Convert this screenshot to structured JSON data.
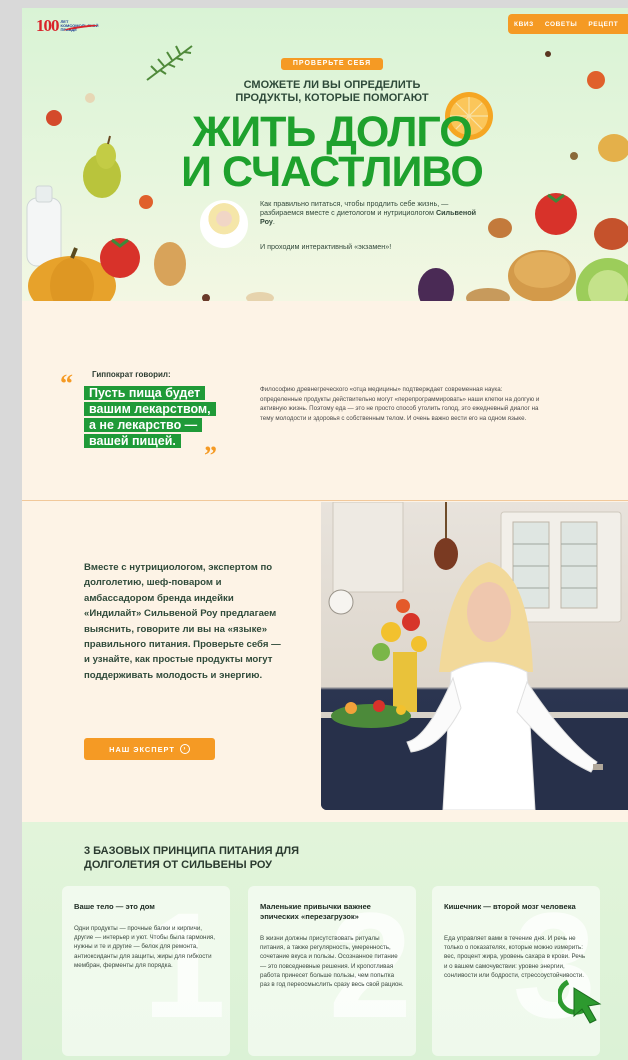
{
  "header": {
    "logo_number": "100",
    "logo_text": "ЛЕТ КОМСОМОЛЬСКОЙ ПРАВДЕ",
    "nav": [
      "КВИЗ",
      "СОВЕТЫ",
      "РЕЦЕПТ"
    ]
  },
  "hero": {
    "badge": "ПРОВЕРЬТЕ СЕБЯ",
    "subtitle": "СМОЖЕТЕ ЛИ ВЫ ОПРЕДЕЛИТЬ ПРОДУКТЫ, КОТОРЫЕ ПОМОГАЮТ",
    "title_line1": "ЖИТЬ ДОЛГО",
    "title_line2": "И СЧАСТЛИВО",
    "desc_pre": "Как правильно питаться, чтобы продлить себе жизнь, — разбираемся вместе с диетологом и нутрициологом ",
    "desc_name": "Сильвеной Роу",
    "desc_post": ".",
    "exam": "И проходим интерактивный «экзамен»!"
  },
  "quote": {
    "author": "Гиппократ говорил:",
    "lines": [
      "Пусть пища будет",
      "вашим лекарством,",
      "а не лекарство —",
      "вашей пищей."
    ],
    "body": "Философию древнегреческого «отца медицины» подтверждает современная наука: определенные продукты действительно могут «перепрограммировать» наши клетки на долгую и активную жизнь. Поэтому еда — это не просто способ утолить голод, это ежедневный диалог на тему молодости и здоровья с собственным телом. И очень важно вести его на одном языке."
  },
  "expert": {
    "text_pre": "Вместе с нутрициологом, экспертом по долголетию, шеф-поваром и амбассадором бренда индейки «Индилайт» ",
    "text_name": "Сильвеной Роу",
    "text_post": " предлагаем выяснить, говорите ли вы на «языке» правильного питания. Проверьте себя — и узнайте, как простые продукты могут поддерживать молодость и энергию.",
    "button": "НАШ ЭКСПЕРТ"
  },
  "principles": {
    "title": "3 БАЗОВЫХ ПРИНЦИПА ПИТАНИЯ ДЛЯ ДОЛГОЛЕТИЯ ОТ СИЛЬВЕНЫ РОУ",
    "cards": [
      {
        "num": "1",
        "title": "Ваше тело — это дом",
        "text": "Одни продукты — прочные балки и кирпичи, другие — интерьер и уют. Чтобы была гармония, нужны и те и другие — белок для ремонта, антиоксиданты для защиты, жиры для гибкости мембран, ферменты для порядка."
      },
      {
        "num": "2",
        "title": "Маленькие привычки важнее эпических «перезагрузок»",
        "text": "В жизни должны присутствовать ритуалы питания, а также регулярность, умеренность, сочетание вкуса и пользы. Осознанное питание — это повседневные решения. И кропотливая работа принесет больше пользы, чем попытка раз в год переосмыслить сразу весь свой рацион."
      },
      {
        "num": "3",
        "title": "Кишечник — второй мозг человека",
        "text": "Еда управляет вами в течение дня. И речь не только о показателях, которые можно измерить: вес, процент жира, уровень сахара в крови. Речь и о вашем самочувствии: уровне энергии, сонливости или бодрости, стрессоустойчивости."
      }
    ]
  },
  "colors": {
    "accent": "#f59a24",
    "green": "#1ea12d",
    "quote_bg": "#1f9a38",
    "page_bg": "#fdf3e6"
  }
}
